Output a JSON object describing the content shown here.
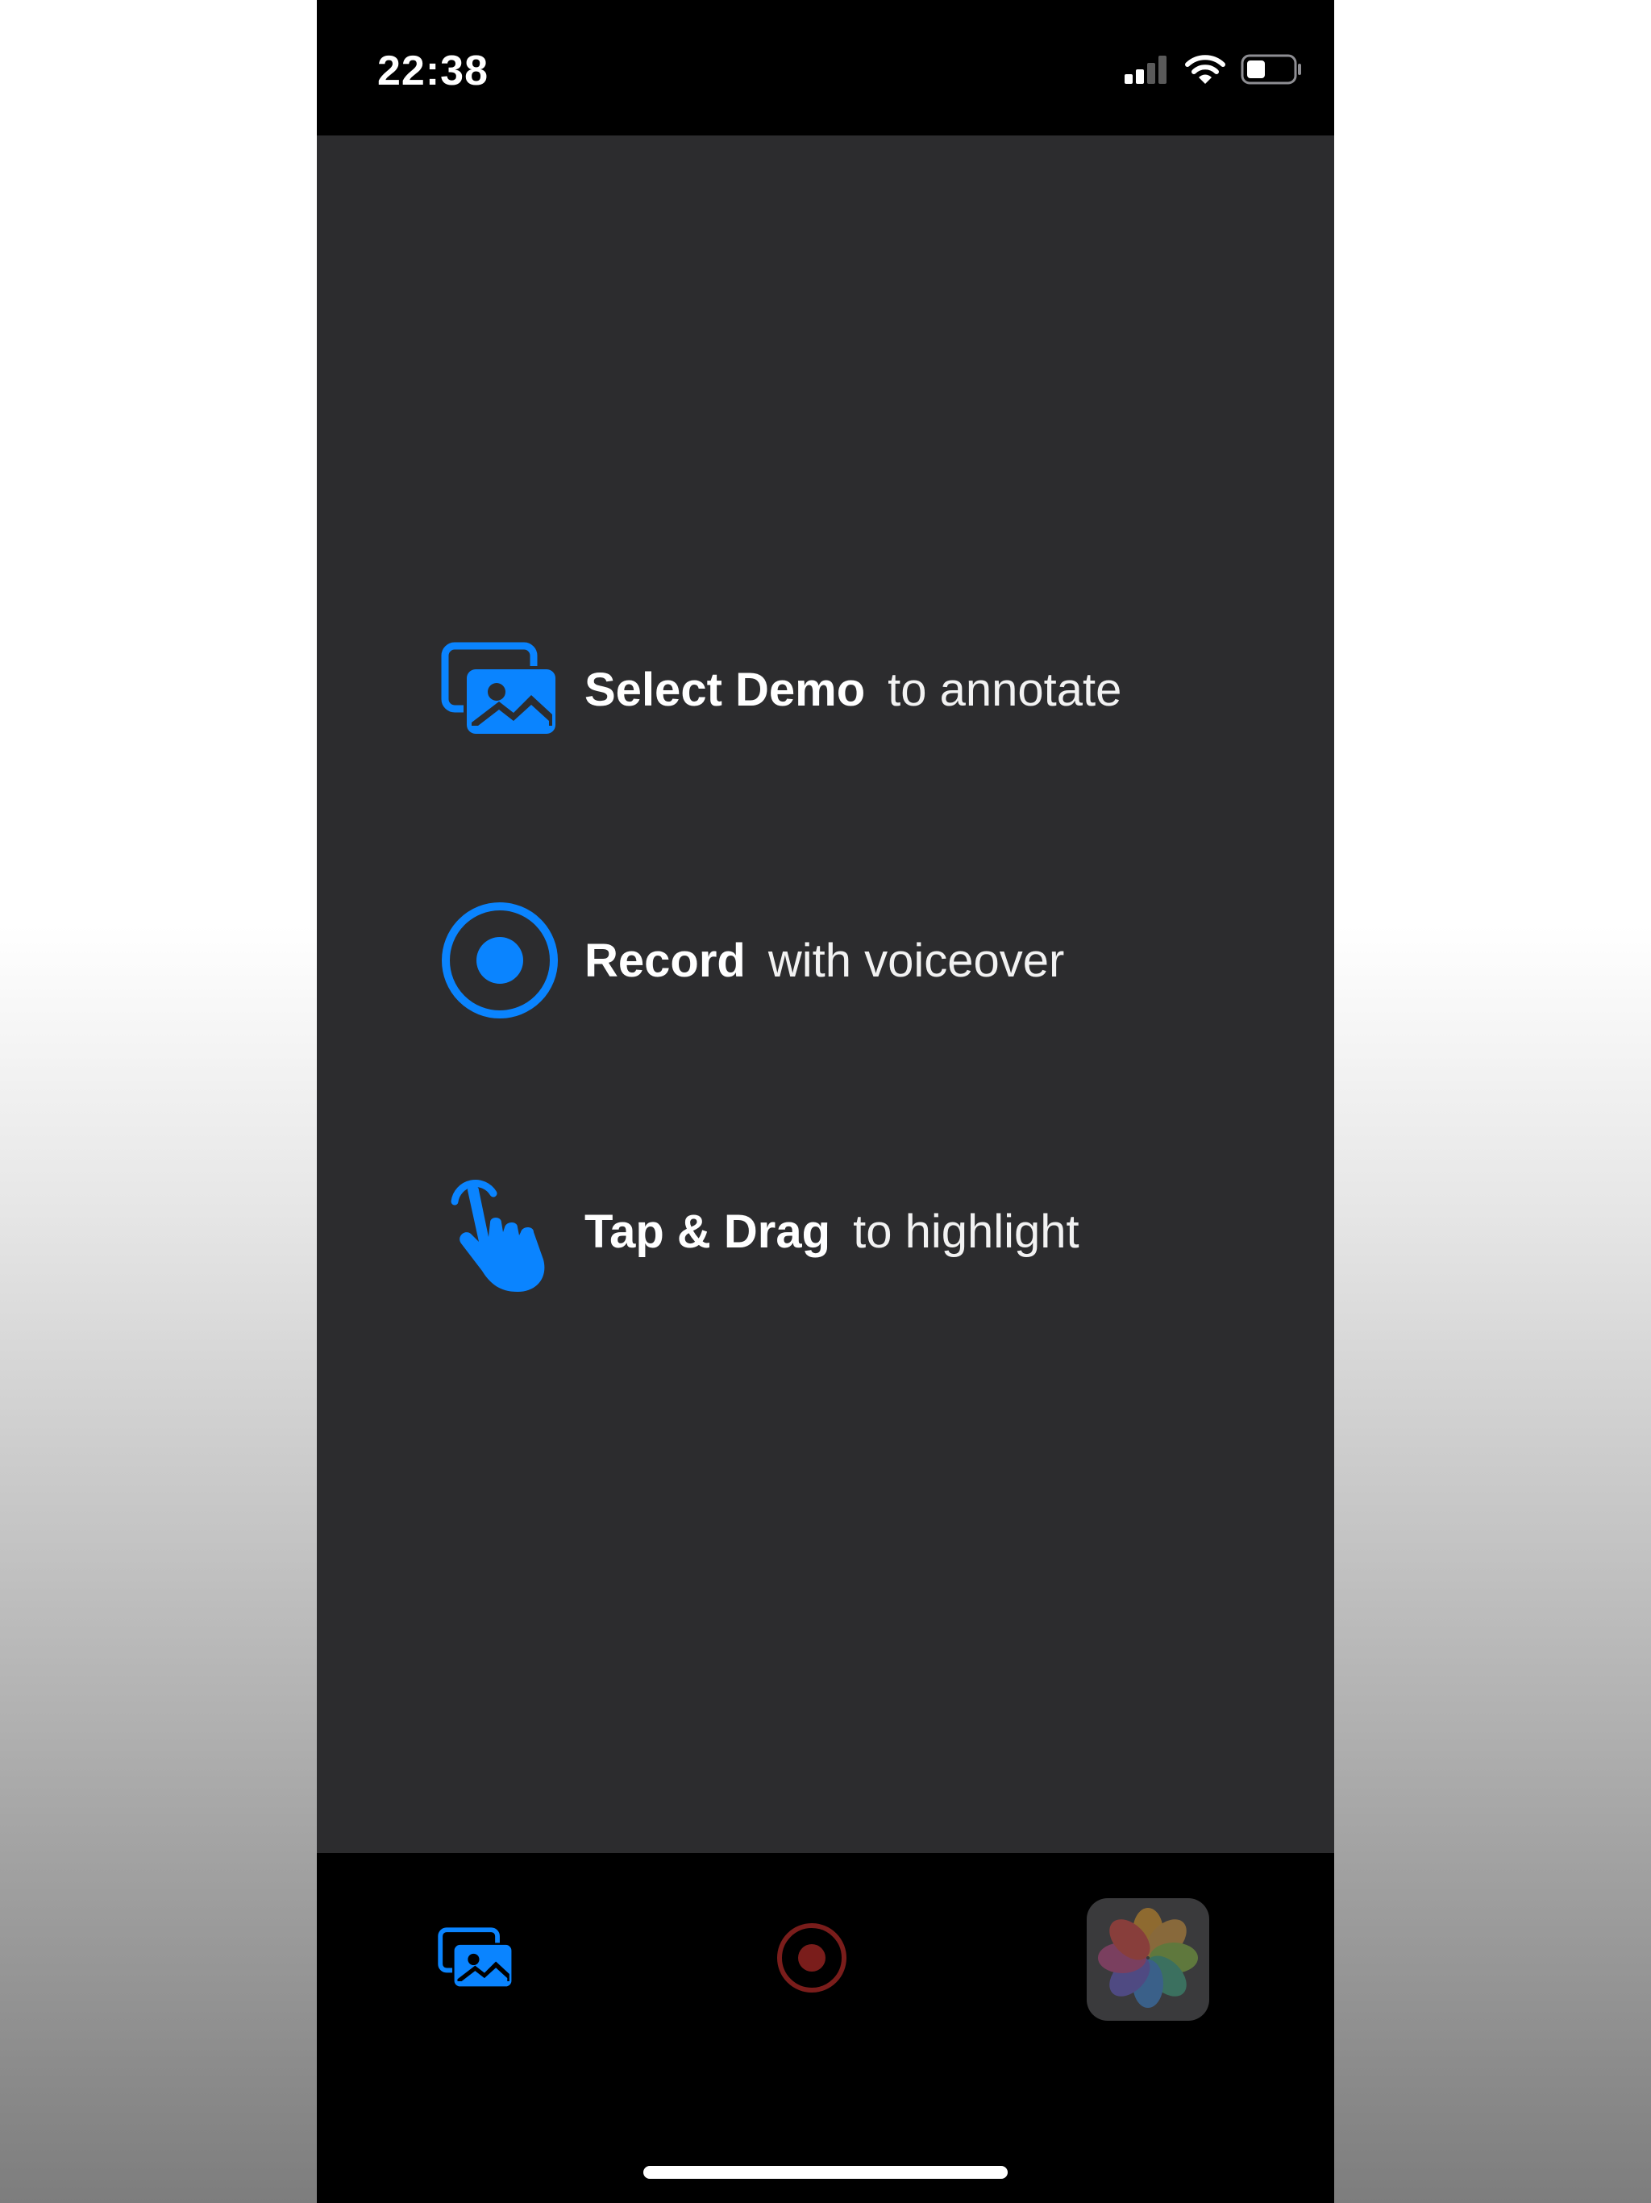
{
  "status_bar": {
    "time": "22:38",
    "icons": [
      "cellular-signal-icon",
      "wifi-icon",
      "battery-icon"
    ]
  },
  "onboarding": {
    "items": [
      {
        "icon": "photo-library-icon",
        "action": "Select Demo",
        "detail": "to annotate"
      },
      {
        "icon": "record-icon",
        "action": "Record",
        "detail": "with voiceover"
      },
      {
        "icon": "tap-drag-hand-icon",
        "action": "Tap & Drag",
        "detail": "to highlight"
      }
    ]
  },
  "toolbar": {
    "buttons": [
      {
        "icon": "photo-library-icon",
        "state": "enabled"
      },
      {
        "icon": "record-icon",
        "state": "disabled"
      },
      {
        "icon": "photos-app-icon",
        "state": "disabled"
      }
    ]
  },
  "colors": {
    "accent": "#0a84ff",
    "record_disabled": "#7a1d1b",
    "content_background": "#2c2c2e",
    "bar_background": "#000000"
  }
}
